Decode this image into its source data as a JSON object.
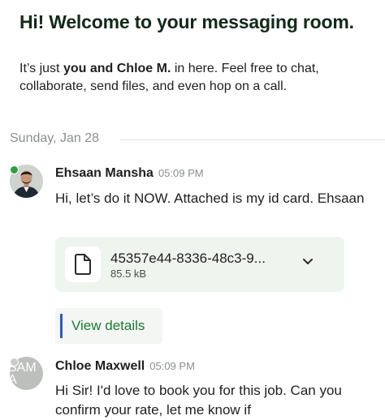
{
  "welcome": {
    "title": "Hi! Welcome to your messaging room.",
    "line_prefix": "It’s just ",
    "line_bold": "you and Chloe  M.",
    "line_suffix": " in here. Feel free to chat, collaborate, send files, and even hop on a call."
  },
  "date_separator": "Sunday, Jan 28",
  "messages": [
    {
      "sender": "Ehsaan Mansha",
      "time": "05:09 PM",
      "text": "Hi, let’s do it NOW. Attached is my id card. Ehsaan",
      "avatar": "user-photo",
      "presence": "online",
      "attachment": {
        "file_name": "45357e44-8336-48c3-9...",
        "file_size": "85.5 kB",
        "icon": "file-icon",
        "action_icon": "chevron-down-icon"
      },
      "view_details_label": "View details"
    },
    {
      "sender": "Chloe  Maxwell",
      "time": "05:09 PM",
      "text": "Hi Sir! I'd love to book you for this job. Can you confirm your rate, let me know if",
      "avatar_initials": "SAMA",
      "presence": "away"
    }
  ],
  "colors": {
    "online": "#2f9e44",
    "link": "#1b7a34",
    "accent_bar": "#2a5cc4",
    "card_bg": "#eef4ee"
  }
}
